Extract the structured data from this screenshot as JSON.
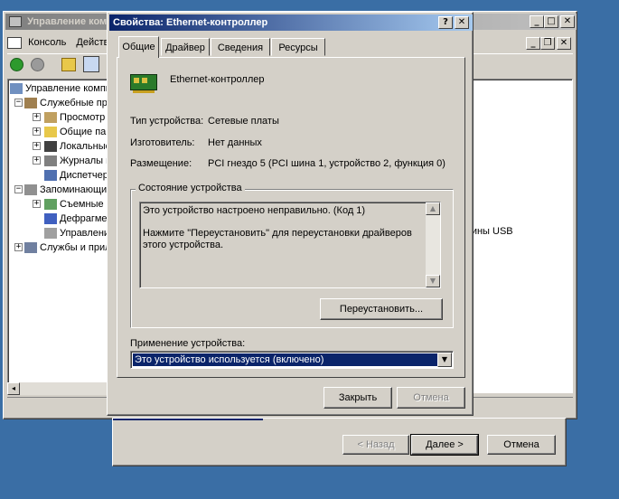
{
  "mmc": {
    "title": "Управление компьютером",
    "menu": {
      "console": "Консоль",
      "action": "Действие"
    },
    "tree": [
      {
        "label": "Управление компьютером (локальным)"
      },
      {
        "label": "Служебные программы"
      },
      {
        "label": "Просмотр событий"
      },
      {
        "label": "Общие папки"
      },
      {
        "label": "Локальные пользователи"
      },
      {
        "label": "Журналы и оповещения"
      },
      {
        "label": "Диспетчер устройств"
      },
      {
        "label": "Запоминающие устройства"
      },
      {
        "label": "Съемные ЗУ"
      },
      {
        "label": "Дефрагментация"
      },
      {
        "label": "Управление дисками"
      },
      {
        "label": "Службы и приложения"
      }
    ],
    "right_text": "шины USB"
  },
  "wizard": {
    "back_label": "< Назад",
    "next_label": "Далее >",
    "cancel_label": "Отмена"
  },
  "dialog": {
    "title": "Свойства: Ethernet-контроллер",
    "help_glyph": "?",
    "close_glyph": "✕",
    "tabs": [
      "Общие",
      "Драйвер",
      "Сведения",
      "Ресурсы"
    ],
    "device_name": "Ethernet-контроллер",
    "props": {
      "type_label": "Тип устройства:",
      "type_value": "Сетевые платы",
      "maker_label": "Изготовитель:",
      "maker_value": "Нет данных",
      "location_label": "Размещение:",
      "location_value": "PCI гнездо 5 (PCI шина 1, устройство 2, функция 0)"
    },
    "status": {
      "group_label": "Состояние устройства",
      "line1": "Это устройство настроено неправильно. (Код 1)",
      "line2": "Нажмите \"Переустановить\" для переустановки драйверов этого устройства."
    },
    "reinstall_label": "Переустановить...",
    "usage_label": "Применение устройства:",
    "usage_value": "Это устройство используется (включено)",
    "close_label": "Закрыть",
    "cancel_label": "Отмена"
  }
}
